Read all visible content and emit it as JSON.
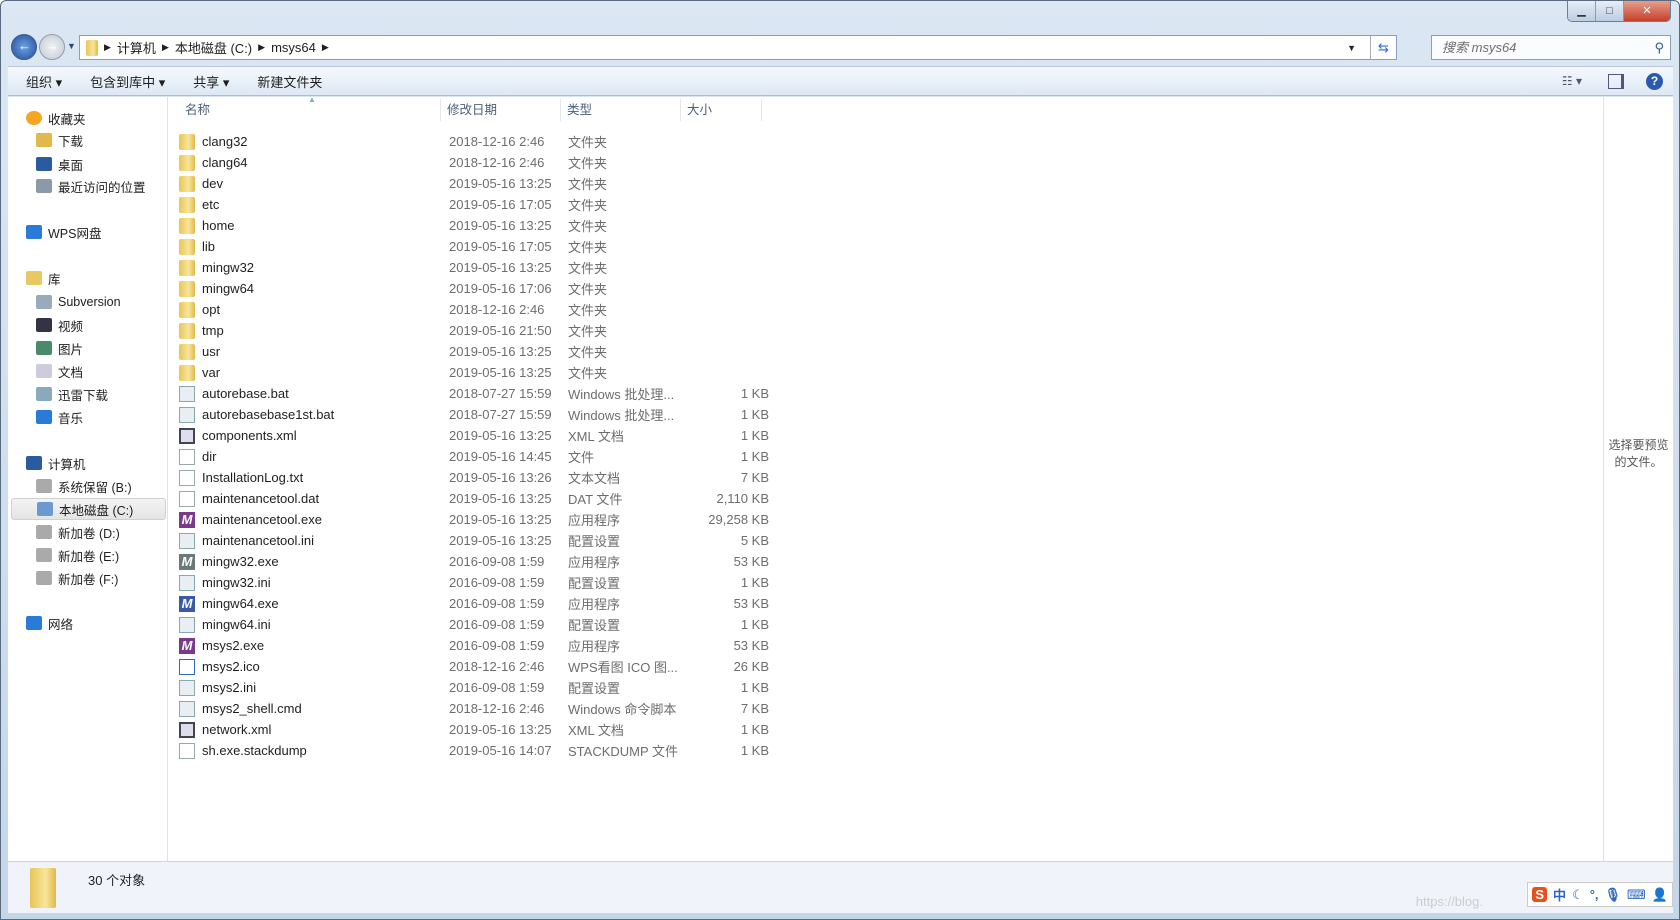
{
  "window": {
    "min": "▁",
    "max": "□",
    "close": "✕"
  },
  "address": {
    "path": [
      "计算机",
      "本地磁盘 (C:)",
      "msys64"
    ]
  },
  "search": {
    "placeholder": "搜索 msys64"
  },
  "toolbar": {
    "organize": "组织 ▾",
    "include_library": "包含到库中 ▾",
    "share": "共享 ▾",
    "new_folder": "新建文件夹"
  },
  "columns": {
    "name": "名称",
    "date": "修改日期",
    "type": "类型",
    "size": "大小"
  },
  "sidebar": [
    {
      "label": "收藏夹",
      "icon": "star-icon",
      "indent": 0,
      "color": "#f5a623"
    },
    {
      "label": "下载",
      "icon": "downloads-icon",
      "indent": 1,
      "color": "#e0b94a"
    },
    {
      "label": "桌面",
      "icon": "desktop-icon",
      "indent": 1,
      "color": "#2a5aa0"
    },
    {
      "label": "最近访问的位置",
      "icon": "recent-places-icon",
      "indent": 1,
      "color": "#8a9aaa"
    },
    {
      "label": "WPS网盘",
      "icon": "cloud-icon",
      "indent": 0,
      "color": "#2a7ad8"
    },
    {
      "label": "库",
      "icon": "library-icon",
      "indent": 0,
      "color": "#e8c860"
    },
    {
      "label": "Subversion",
      "icon": "library-doc-icon",
      "indent": 1,
      "color": "#9ab"
    },
    {
      "label": "视频",
      "icon": "video-icon",
      "indent": 1,
      "color": "#334"
    },
    {
      "label": "图片",
      "icon": "pictures-icon",
      "indent": 1,
      "color": "#4a8a6a"
    },
    {
      "label": "文档",
      "icon": "documents-icon",
      "indent": 1,
      "color": "#ccd"
    },
    {
      "label": "迅雷下载",
      "icon": "library-doc-icon",
      "indent": 1,
      "color": "#8ab"
    },
    {
      "label": "音乐",
      "icon": "music-icon",
      "indent": 1,
      "color": "#2a7ad8"
    },
    {
      "label": "计算机",
      "icon": "computer-icon",
      "indent": 0,
      "color": "#2a5aa0"
    },
    {
      "label": "系统保留 (B:)",
      "icon": "drive-icon",
      "indent": 1,
      "color": "#aaa"
    },
    {
      "label": "本地磁盘 (C:)",
      "icon": "system-drive-icon",
      "indent": 1,
      "color": "#6a9ad0",
      "selected": true
    },
    {
      "label": "新加卷 (D:)",
      "icon": "drive-icon",
      "indent": 1,
      "color": "#aaa"
    },
    {
      "label": "新加卷 (E:)",
      "icon": "drive-icon",
      "indent": 1,
      "color": "#aaa"
    },
    {
      "label": "新加卷 (F:)",
      "icon": "drive-icon",
      "indent": 1,
      "color": "#aaa"
    },
    {
      "label": "网络",
      "icon": "network-icon",
      "indent": 0,
      "color": "#2a7ad8"
    }
  ],
  "files": [
    {
      "name": "clang32",
      "date": "2018-12-16 2:46",
      "type": "文件夹",
      "size": "",
      "icon": "folder-icon"
    },
    {
      "name": "clang64",
      "date": "2018-12-16 2:46",
      "type": "文件夹",
      "size": "",
      "icon": "folder-icon"
    },
    {
      "name": "dev",
      "date": "2019-05-16 13:25",
      "type": "文件夹",
      "size": "",
      "icon": "folder-icon"
    },
    {
      "name": "etc",
      "date": "2019-05-16 17:05",
      "type": "文件夹",
      "size": "",
      "icon": "folder-icon"
    },
    {
      "name": "home",
      "date": "2019-05-16 13:25",
      "type": "文件夹",
      "size": "",
      "icon": "folder-icon"
    },
    {
      "name": "lib",
      "date": "2019-05-16 17:05",
      "type": "文件夹",
      "size": "",
      "icon": "folder-icon"
    },
    {
      "name": "mingw32",
      "date": "2019-05-16 13:25",
      "type": "文件夹",
      "size": "",
      "icon": "folder-icon"
    },
    {
      "name": "mingw64",
      "date": "2019-05-16 17:06",
      "type": "文件夹",
      "size": "",
      "icon": "folder-icon"
    },
    {
      "name": "opt",
      "date": "2018-12-16 2:46",
      "type": "文件夹",
      "size": "",
      "icon": "folder-icon"
    },
    {
      "name": "tmp",
      "date": "2019-05-16 21:50",
      "type": "文件夹",
      "size": "",
      "icon": "folder-icon"
    },
    {
      "name": "usr",
      "date": "2019-05-16 13:25",
      "type": "文件夹",
      "size": "",
      "icon": "folder-icon"
    },
    {
      "name": "var",
      "date": "2019-05-16 13:25",
      "type": "文件夹",
      "size": "",
      "icon": "folder-icon"
    },
    {
      "name": "autorebase.bat",
      "date": "2018-07-27 15:59",
      "type": "Windows 批处理...",
      "size": "1 KB",
      "icon": "batch-file-icon"
    },
    {
      "name": "autorebasebase1st.bat",
      "date": "2018-07-27 15:59",
      "type": "Windows 批处理...",
      "size": "1 KB",
      "icon": "batch-file-icon"
    },
    {
      "name": "components.xml",
      "date": "2019-05-16 13:25",
      "type": "XML 文档",
      "size": "1 KB",
      "icon": "xml-file-icon"
    },
    {
      "name": "dir",
      "date": "2019-05-16 14:45",
      "type": "文件",
      "size": "1 KB",
      "icon": "blank-file-icon"
    },
    {
      "name": "InstallationLog.txt",
      "date": "2019-05-16 13:26",
      "type": "文本文档",
      "size": "7 KB",
      "icon": "text-file-icon"
    },
    {
      "name": "maintenancetool.dat",
      "date": "2019-05-16 13:25",
      "type": "DAT 文件",
      "size": "2,110 KB",
      "icon": "blank-file-icon"
    },
    {
      "name": "maintenancetool.exe",
      "date": "2019-05-16 13:25",
      "type": "应用程序",
      "size": "29,258 KB",
      "icon": "msys-exe-icon",
      "color": "#7a3a8a"
    },
    {
      "name": "maintenancetool.ini",
      "date": "2019-05-16 13:25",
      "type": "配置设置",
      "size": "5 KB",
      "icon": "ini-file-icon"
    },
    {
      "name": "mingw32.exe",
      "date": "2016-09-08 1:59",
      "type": "应用程序",
      "size": "53 KB",
      "icon": "msys-exe-icon",
      "color": "#6a7a7a"
    },
    {
      "name": "mingw32.ini",
      "date": "2016-09-08 1:59",
      "type": "配置设置",
      "size": "1 KB",
      "icon": "ini-file-icon"
    },
    {
      "name": "mingw64.exe",
      "date": "2016-09-08 1:59",
      "type": "应用程序",
      "size": "53 KB",
      "icon": "msys-exe-icon",
      "color": "#3a5aa8"
    },
    {
      "name": "mingw64.ini",
      "date": "2016-09-08 1:59",
      "type": "配置设置",
      "size": "1 KB",
      "icon": "ini-file-icon"
    },
    {
      "name": "msys2.exe",
      "date": "2016-09-08 1:59",
      "type": "应用程序",
      "size": "53 KB",
      "icon": "msys-exe-icon",
      "color": "#7a3a8a"
    },
    {
      "name": "msys2.ico",
      "date": "2018-12-16 2:46",
      "type": "WPS看图 ICO 图...",
      "size": "26 KB",
      "icon": "ico-file-icon"
    },
    {
      "name": "msys2.ini",
      "date": "2016-09-08 1:59",
      "type": "配置设置",
      "size": "1 KB",
      "icon": "ini-file-icon"
    },
    {
      "name": "msys2_shell.cmd",
      "date": "2018-12-16 2:46",
      "type": "Windows 命令脚本",
      "size": "7 KB",
      "icon": "batch-file-icon"
    },
    {
      "name": "network.xml",
      "date": "2019-05-16 13:25",
      "type": "XML 文档",
      "size": "1 KB",
      "icon": "xml-file-icon"
    },
    {
      "name": "sh.exe.stackdump",
      "date": "2019-05-16 14:07",
      "type": "STACKDUMP 文件",
      "size": "1 KB",
      "icon": "blank-file-icon"
    }
  ],
  "preview": {
    "text": "选择要预览的文件。"
  },
  "status": {
    "count": "30 个对象"
  },
  "watermark": "https://blog.",
  "ime": {
    "lang": "中"
  }
}
